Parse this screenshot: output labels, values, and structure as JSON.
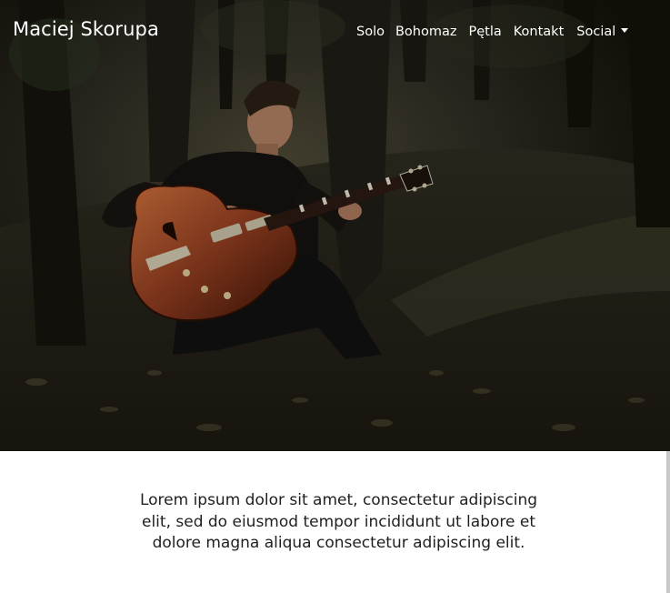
{
  "navbar": {
    "brand": "Maciej Skorupa",
    "links": [
      {
        "label": "Solo"
      },
      {
        "label": "Bohomaz"
      },
      {
        "label": "Pętla"
      },
      {
        "label": "Kontakt"
      },
      {
        "label": "Social"
      }
    ]
  },
  "hero": {
    "image": "guitarist-in-forest-photo"
  },
  "content": {
    "lead": "Lorem ipsum dolor sit amet, consectetur adipiscing elit, sed do eiusmod tempor incididunt ut labore et dolore magna aliqua consectetur adipiscing elit."
  },
  "colors": {
    "nav_text": "#ffffff",
    "body_text": "#1f1f1f",
    "hero_dark": "#1b1a14",
    "guitar_body": "#8a3a1e"
  }
}
